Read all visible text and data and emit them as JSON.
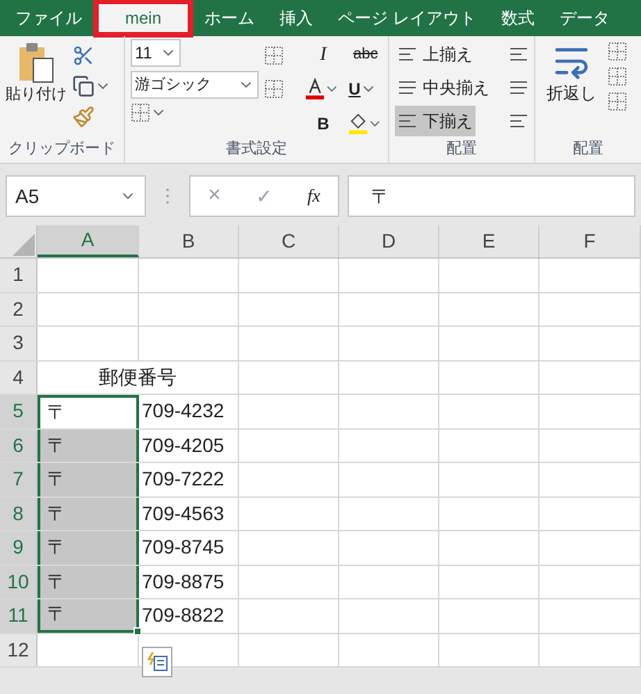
{
  "tabs": [
    {
      "label": "ファイル",
      "selected": false,
      "highlighted": false
    },
    {
      "label": "mein",
      "selected": true,
      "highlighted": true
    },
    {
      "label": "ホーム",
      "selected": false,
      "highlighted": false
    },
    {
      "label": "挿入",
      "selected": false,
      "highlighted": false
    },
    {
      "label": "ページ レイアウト",
      "selected": false,
      "highlighted": false
    },
    {
      "label": "数式",
      "selected": false,
      "highlighted": false
    },
    {
      "label": "データ",
      "selected": false,
      "highlighted": false
    }
  ],
  "ribbon": {
    "clipboard": {
      "paste_label": "貼り付け",
      "group_label": "クリップボード"
    },
    "font": {
      "size": "11",
      "name": "游ゴシック",
      "italic_label": "I",
      "strike_label": "abc",
      "bold_label": "B",
      "underline_label": "U",
      "group_label": "書式設定"
    },
    "alignment": {
      "options": [
        {
          "label": "上揃え",
          "selected": false
        },
        {
          "label": "中央揃え",
          "selected": false
        },
        {
          "label": "下揃え",
          "selected": true
        }
      ],
      "group_label": "配置"
    },
    "wrap": {
      "label": "折返し",
      "group_label": "配置"
    }
  },
  "formula_bar": {
    "name_box": "A5",
    "cancel": "×",
    "confirm": "✓",
    "fx": "fx",
    "value": "〒"
  },
  "columns": [
    {
      "label": "A",
      "selected": true
    },
    {
      "label": "B",
      "selected": false
    },
    {
      "label": "C",
      "selected": false
    },
    {
      "label": "D",
      "selected": false
    },
    {
      "label": "E",
      "selected": false
    },
    {
      "label": "F",
      "selected": false
    }
  ],
  "rows": [
    {
      "number": "1",
      "selected": false
    },
    {
      "number": "2",
      "selected": false
    },
    {
      "number": "3",
      "selected": false
    },
    {
      "number": "4",
      "selected": false,
      "cells": [
        {
          "text": "郵便番号",
          "kind": "merged",
          "selected": false
        }
      ]
    },
    {
      "number": "5",
      "selected": true,
      "cells": [
        {
          "text": "〒",
          "kind": "text",
          "selected": true,
          "active": true
        },
        {
          "text": "709-4232",
          "kind": "text",
          "selected": false
        }
      ]
    },
    {
      "number": "6",
      "selected": true,
      "cells": [
        {
          "text": "〒",
          "kind": "text",
          "selected": true,
          "active": false
        },
        {
          "text": "709-4205",
          "kind": "text",
          "selected": false
        }
      ]
    },
    {
      "number": "7",
      "selected": true,
      "cells": [
        {
          "text": "〒",
          "kind": "text",
          "selected": true,
          "active": false
        },
        {
          "text": "709-7222",
          "kind": "text",
          "selected": false
        }
      ]
    },
    {
      "number": "8",
      "selected": true,
      "cells": [
        {
          "text": "〒",
          "kind": "text",
          "selected": true,
          "active": false
        },
        {
          "text": "709-4563",
          "kind": "text",
          "selected": false
        }
      ]
    },
    {
      "number": "9",
      "selected": true,
      "cells": [
        {
          "text": "〒",
          "kind": "text",
          "selected": true,
          "active": false
        },
        {
          "text": "709-8745",
          "kind": "text",
          "selected": false
        }
      ]
    },
    {
      "number": "10",
      "selected": true,
      "cells": [
        {
          "text": "〒",
          "kind": "text",
          "selected": true,
          "active": false
        },
        {
          "text": "709-8875",
          "kind": "text",
          "selected": false
        }
      ]
    },
    {
      "number": "11",
      "selected": true,
      "cells": [
        {
          "text": "〒",
          "kind": "text",
          "selected": true,
          "active": false
        },
        {
          "text": "709-8822",
          "kind": "text",
          "selected": false
        }
      ]
    },
    {
      "number": "12",
      "selected": false,
      "flash_fill": true
    }
  ]
}
